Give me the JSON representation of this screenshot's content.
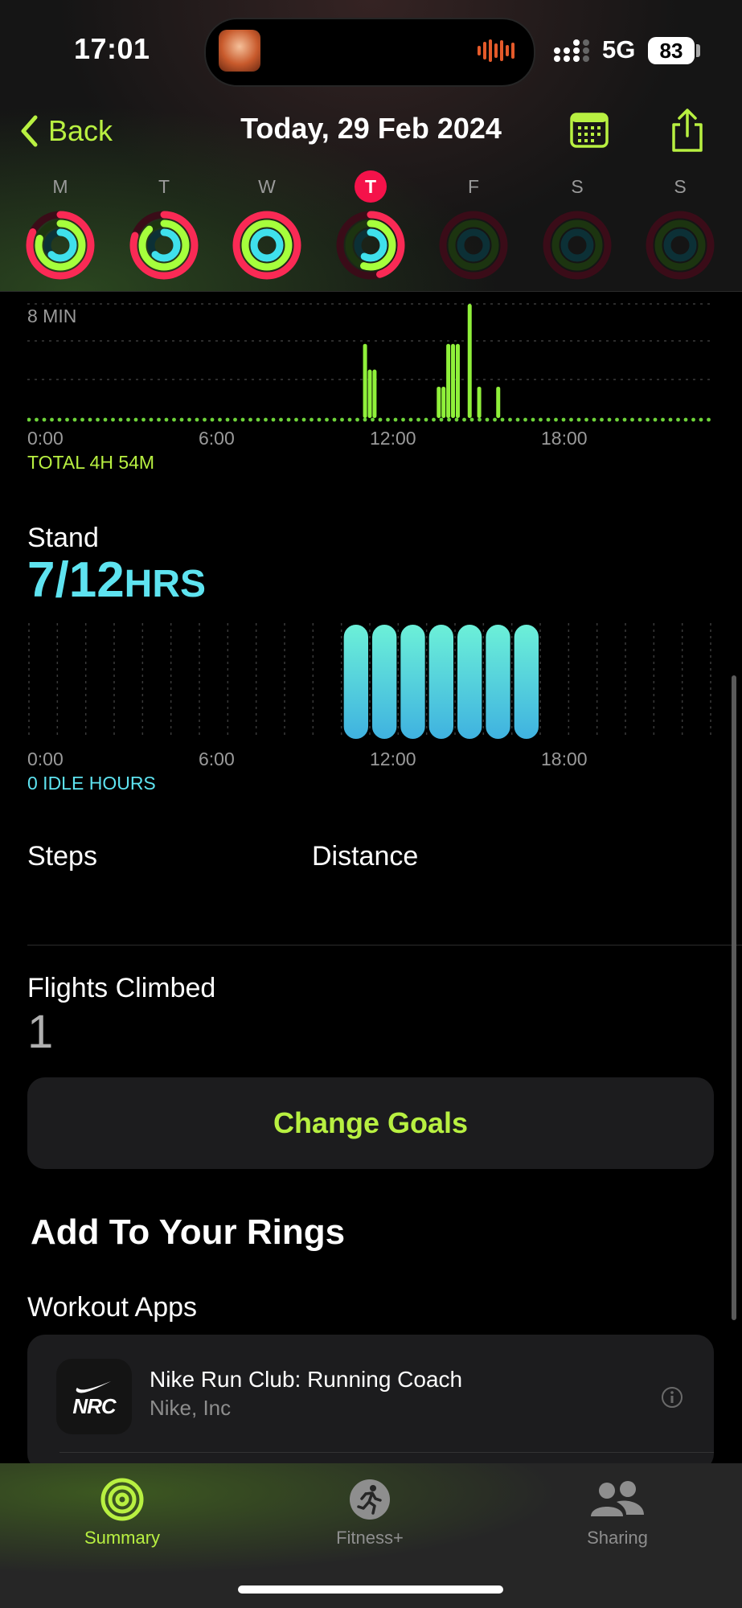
{
  "status_bar": {
    "time": "17:01",
    "network": "5G",
    "battery": "83"
  },
  "nav": {
    "back_label": "Back",
    "title": "Today, 29 Feb 2024"
  },
  "week": {
    "days": [
      {
        "label": "M",
        "today": false
      },
      {
        "label": "T",
        "today": false
      },
      {
        "label": "W",
        "today": false
      },
      {
        "label": "T",
        "today": true
      },
      {
        "label": "F",
        "today": false
      },
      {
        "label": "S",
        "today": false
      },
      {
        "label": "S",
        "today": false
      }
    ],
    "rings": [
      {
        "move": 0.82,
        "exercise": 0.8,
        "stand": 0.62
      },
      {
        "move": 0.8,
        "exercise": 0.88,
        "stand": 0.62
      },
      {
        "move": 1.0,
        "exercise": 1.0,
        "stand": 1.0
      },
      {
        "move": 0.45,
        "exercise": 0.55,
        "stand": 0.58
      },
      {
        "move": 0,
        "exercise": 0,
        "stand": 0
      },
      {
        "move": 0,
        "exercise": 0,
        "stand": 0
      },
      {
        "move": 0,
        "exercise": 0,
        "stand": 0
      }
    ],
    "colors": {
      "move": "#fa2a55",
      "exercise": "#a6ff3c",
      "stand": "#3fe0ec"
    }
  },
  "exercise": {
    "max_label": "8 MIN",
    "total_label": "TOTAL 4H 54M",
    "x_ticks": [
      "0:00",
      "6:00",
      "12:00",
      "18:00"
    ]
  },
  "stand": {
    "title": "Stand",
    "value": "7/12",
    "unit": "HRS",
    "idle_label": "0 IDLE HOURS",
    "x_ticks": [
      "0:00",
      "6:00",
      "12:00",
      "18:00"
    ]
  },
  "metrics": {
    "steps_label": "Steps",
    "distance_label": "Distance",
    "flights_label": "Flights Climbed",
    "flights_value": "1"
  },
  "change_goals_label": "Change Goals",
  "add_rings": {
    "title": "Add To Your Rings",
    "section_label": "Workout Apps",
    "apps": [
      {
        "name": "Nike Run Club: Running Coach",
        "developer": "Nike, Inc",
        "icon_text": "NRC"
      }
    ]
  },
  "tabbar": {
    "tabs": [
      {
        "label": "Summary",
        "active": true,
        "icon": "summary-rings-icon"
      },
      {
        "label": "Fitness+",
        "active": false,
        "icon": "runner-icon"
      },
      {
        "label": "Sharing",
        "active": false,
        "icon": "people-icon"
      }
    ]
  },
  "chart_data": [
    {
      "type": "bar",
      "title": "",
      "x_ticks": [
        "0:00",
        "6:00",
        "12:00",
        "18:00"
      ],
      "x_unit": "hour of day",
      "ylabel": "minutes",
      "ylim": [
        0,
        8
      ],
      "series": [
        {
          "values_by_5min_slot": {
            "142": 5.2,
            "144": 3.4,
            "146": 3.4,
            "173": 2.2,
            "175": 2.2,
            "177": 5.2,
            "179": 5.2,
            "181": 5.2,
            "186": 8,
            "190": 2.2,
            "198": 2.2
          }
        }
      ],
      "footer": "TOTAL 4H 54M"
    },
    {
      "type": "bar",
      "title": "Stand",
      "x_ticks": [
        "0:00",
        "6:00",
        "12:00",
        "18:00"
      ],
      "categories_hours": [
        11,
        12,
        13,
        14,
        15,
        16,
        17
      ],
      "values": [
        1,
        1,
        1,
        1,
        1,
        1,
        1
      ],
      "footer": "0 IDLE HOURS"
    }
  ]
}
